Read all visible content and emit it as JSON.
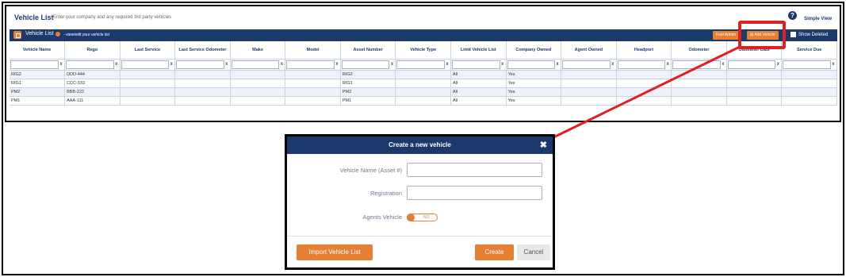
{
  "header": {
    "title": "Vehicle List",
    "subtitle": "Enter your company and any required 3rd party vehicles",
    "simple_view": "Simple View"
  },
  "panel": {
    "title": "Vehicle List",
    "subtitle": "- view/edit your vehicle list",
    "fuel_admin": "Fuel Admin",
    "add_vehicle": "Add Vehicle",
    "show_deleted": "Show Deleted"
  },
  "table": {
    "columns": [
      "Vehicle Name",
      "Rego",
      "Last Service",
      "Last Service Odometer",
      "Make",
      "Model",
      "Asset Number",
      "Vehicle Type",
      "Limit Vehicle List",
      "Company Owned",
      "Agent Owned",
      "Headport",
      "Odometer",
      "Odometer Date",
      "Service Due"
    ],
    "rows": [
      [
        "RIG2",
        "DDD-444",
        "",
        "",
        "",
        "",
        "RIG2",
        "",
        "All",
        "Yes",
        "",
        "",
        "",
        "",
        ""
      ],
      [
        "RIG1",
        "CCC-333",
        "",
        "",
        "",
        "",
        "RIG1",
        "",
        "All",
        "Yes",
        "",
        "",
        "",
        "",
        ""
      ],
      [
        "PM2",
        "BBB-222",
        "",
        "",
        "",
        "",
        "PM2",
        "",
        "All",
        "Yes",
        "",
        "",
        "",
        "",
        ""
      ],
      [
        "PM1",
        "AAA-111",
        "",
        "",
        "",
        "",
        "PM1",
        "",
        "All",
        "Yes",
        "",
        "",
        "",
        "",
        ""
      ]
    ]
  },
  "modal": {
    "title": "Create a new vehicle",
    "vehicle_name_label": "Vehicle Name (Asset #)",
    "registration_label": "Registration",
    "agents_vehicle_label": "Agents Vehicle",
    "toggle_text": "NO",
    "import_label": "Import Vehicle List",
    "create_label": "Create",
    "cancel_label": "Cancel"
  },
  "colors": {
    "navy": "#1b3a6b",
    "accent": "#e47f34",
    "highlight": "#e02020"
  }
}
